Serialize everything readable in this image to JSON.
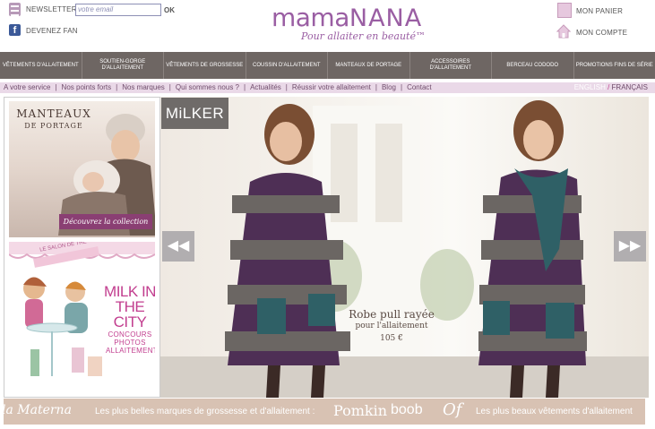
{
  "header": {
    "newsletter_label": "NEWSLETTER",
    "email_placeholder": "votre email",
    "ok_label": "OK",
    "facebook_label": "DEVENEZ FAN",
    "logo_mama": "mama",
    "logo_nana": "NANA",
    "tagline": "Pour allaiter en beauté™",
    "cart_label": "MON PANIER",
    "account_label": "MON COMPTE"
  },
  "nav": [
    "Vêtements d'allaitement",
    "Soutien-gorge d'allaitement",
    "Vêtements de grossesse",
    "Coussin d'allaitement",
    "Manteaux de portage",
    "Accessoires d'allaitement",
    "Berceau Cododo",
    "Promotions fins de série"
  ],
  "subnav": {
    "items": [
      "A votre service",
      "Nos points forts",
      "Nos marques",
      "Qui sommes nous ?",
      "Actualités",
      "Réussir votre allaitement",
      "Blog",
      "Contact"
    ],
    "lang_en": "ENGLISH",
    "lang_sep": "/",
    "lang_fr": "FRANÇAIS"
  },
  "promo1": {
    "title_line1": "Manteaux",
    "title_line2": "de portage",
    "button": "Découvrez la collection"
  },
  "promo2": {
    "title": "MILK IN THE CITY",
    "subtitle": "CONCOURS PHOTOS ALLAITEMENT",
    "awning": "LE SALON DE THÉ"
  },
  "hero": {
    "brand_badge": "MiLKER",
    "prev": "◀◀",
    "next": "▶▶",
    "product_name": "Robe pull rayée",
    "product_sub": "pour l'allaitement",
    "price": "105 €"
  },
  "strip": {
    "brand_left": "la Materna",
    "text1": "Les plus belles marques de grossesse et d'allaitement :",
    "brand1": "Pomkin",
    "brand2": "boob",
    "brand3": "Of",
    "text2": "Les plus beaux vêtements d'allaitement"
  },
  "colors": {
    "brand": "#9a5ea3",
    "nav_bg": "#6e6663",
    "subnav_bg": "#ead9e8",
    "button": "#8a3f73",
    "strip_bg": "#d8c2b3"
  }
}
